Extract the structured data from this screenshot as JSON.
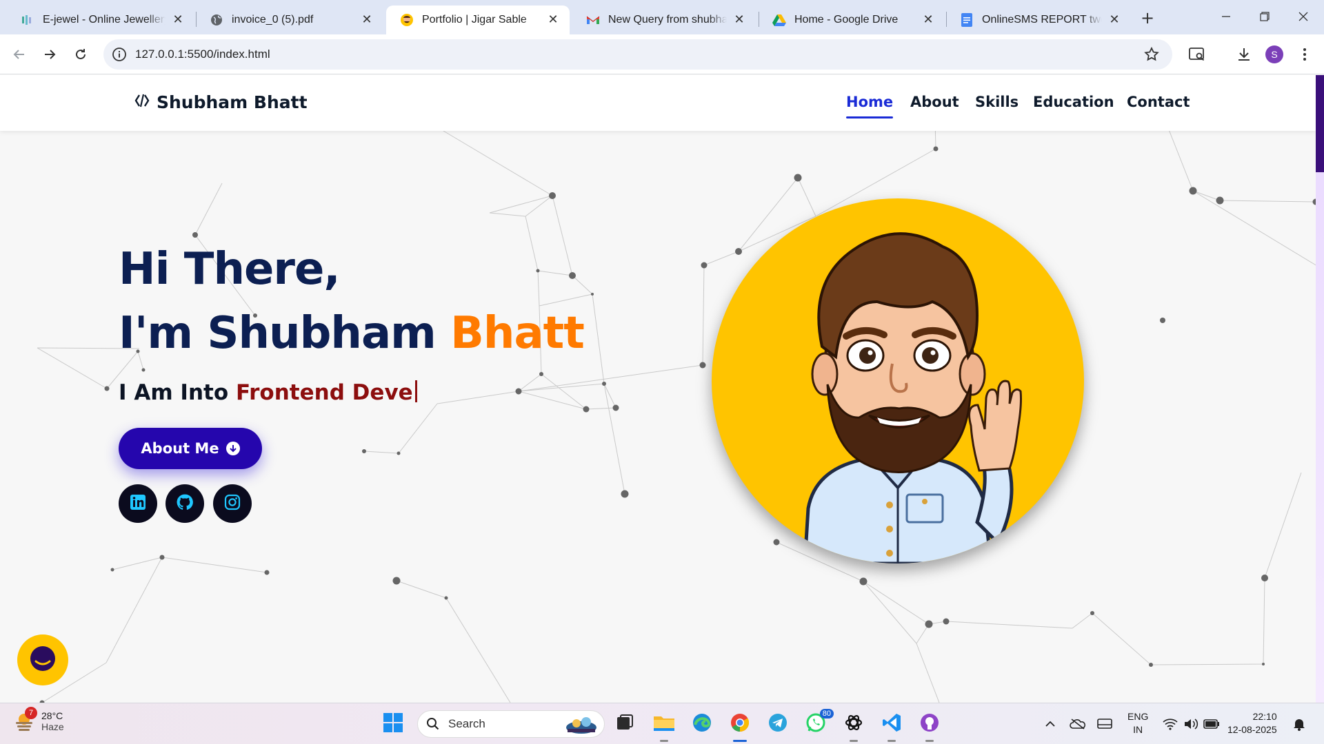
{
  "browser": {
    "tabs": [
      {
        "title": "E-jewel - Online Jewellery s",
        "icon": "jewel-favicon"
      },
      {
        "title": "invoice_0 (5).pdf",
        "icon": "globe-icon"
      },
      {
        "title": "Portfolio | Jigar Sable",
        "icon": "avatar-favicon",
        "active": true
      },
      {
        "title": "New Query from shubham",
        "icon": "gmail-icon"
      },
      {
        "title": "Home - Google Drive",
        "icon": "google-drive-icon"
      },
      {
        "title": "OnlineSMS REPORT two.do",
        "icon": "google-docs-icon"
      }
    ],
    "url": "127.0.0.1:5500/index.html",
    "profile_initial": "S"
  },
  "site": {
    "brand_icon": "code-icon",
    "brand_name": "Shubham Bhatt",
    "nav": [
      {
        "label": "Home",
        "active": true
      },
      {
        "label": "About"
      },
      {
        "label": "Skills"
      },
      {
        "label": "Education"
      },
      {
        "label": "Contact"
      }
    ],
    "hero": {
      "line1": "Hi There,",
      "line2_prefix": "I'm Shubham ",
      "line2_highlight": "Bhatt",
      "sub_prefix": "I Am Into ",
      "sub_typed": "Frontend Deve",
      "button_label": "About Me",
      "socials": [
        "linkedin-icon",
        "github-icon",
        "instagram-icon"
      ]
    },
    "colors": {
      "heading": "#0c1f52",
      "highlight": "#ff7a00",
      "typed": "#8c0e0e",
      "button": "#2506ad",
      "avatar_bg": "#ffc400"
    }
  },
  "taskbar": {
    "weather_temp": "28°C",
    "weather_desc": "Haze",
    "weather_badge": "7",
    "search_label": "Search",
    "whatsapp_badge": "80",
    "lang_1": "ENG",
    "lang_2": "IN",
    "time": "22:10",
    "date": "12-08-2025"
  }
}
